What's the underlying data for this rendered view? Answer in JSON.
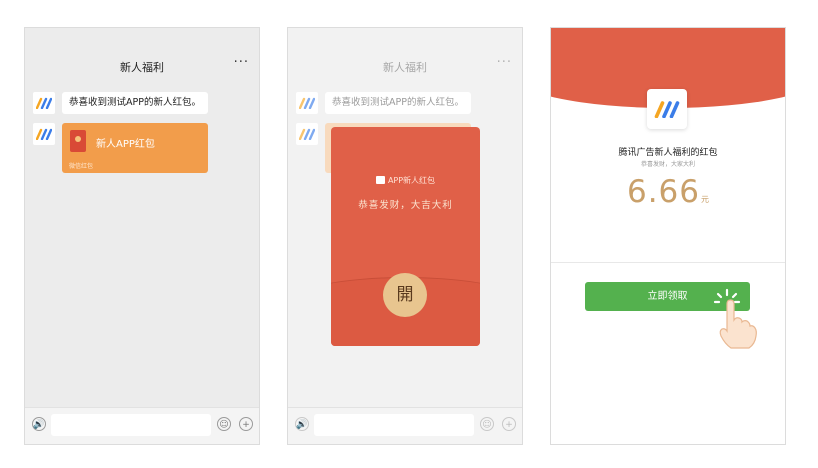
{
  "chat": {
    "title": "新人福利",
    "more": "···",
    "message_text": "恭喜收到测试APP的新人红包。",
    "red_packet": {
      "title": "新人APP红包",
      "footer": "微信红包"
    },
    "input": {
      "placeholder": ""
    },
    "voice_icon": "🔊",
    "emoji_icon": "☺",
    "plus_icon": "+"
  },
  "popup": {
    "header": "APP新人红包",
    "blessing": "恭喜发财，大吉大利",
    "open_button": "開"
  },
  "detail": {
    "sender": "腾讯广告新人福利的红包",
    "subtitle": "恭喜发财，大家大利",
    "amount": "6.66",
    "unit": "元",
    "claim_button": "立即领取"
  },
  "colors": {
    "red": "#e06048",
    "orange": "#f29d4b",
    "gold": "#c9a06a",
    "green": "#54b14e"
  }
}
